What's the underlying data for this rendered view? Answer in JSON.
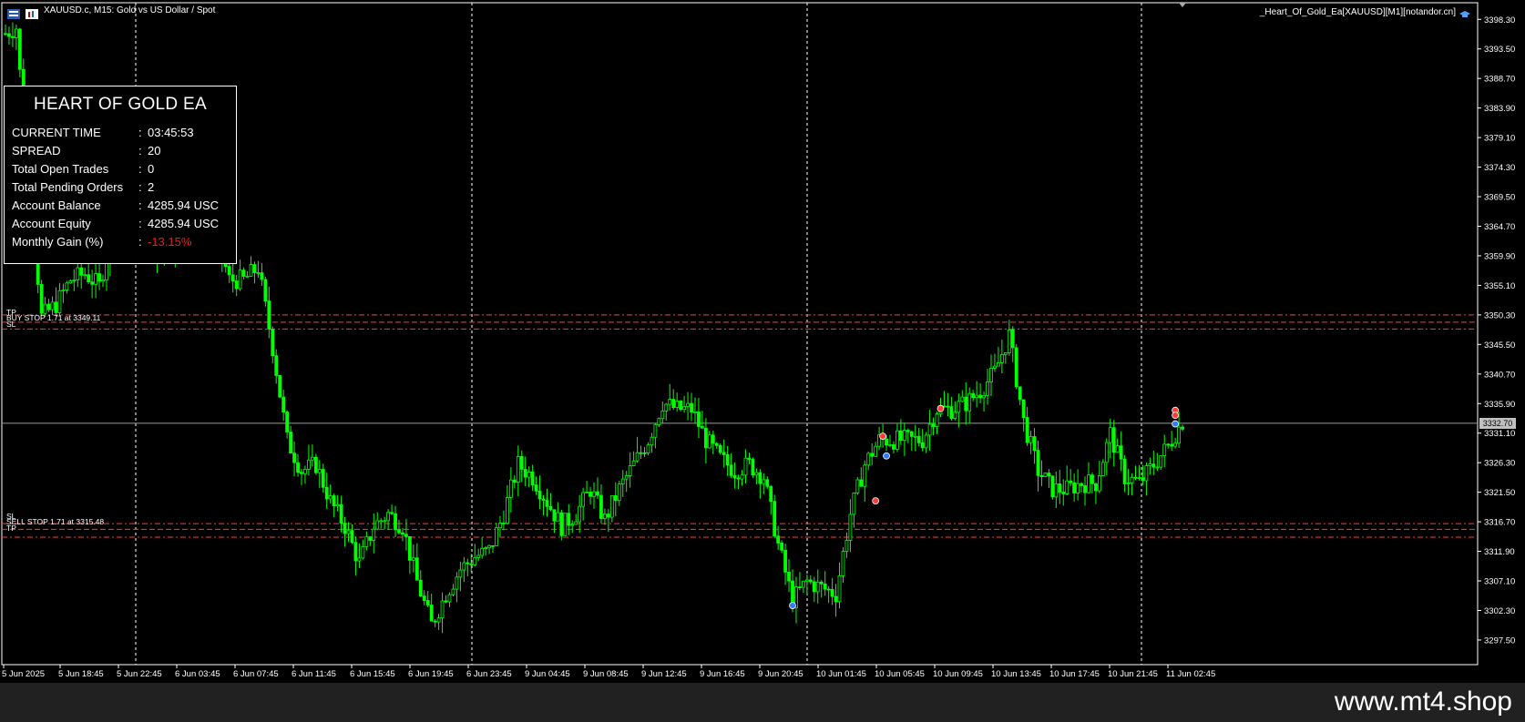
{
  "header": {
    "symbol_title": "XAUUSD.c, M15:  Gold vs US Dollar / Spot",
    "ea_label": "_Heart_Of_Gold_Ea[XAUUSD][M1][notandor.cn]"
  },
  "panel": {
    "title": "HEART OF GOLD EA",
    "rows": [
      {
        "label": "CURRENT TIME",
        "value": "03:45:53"
      },
      {
        "label": "SPREAD",
        "value": "20"
      },
      {
        "label": "Total Open Trades",
        "value": "0"
      },
      {
        "label": "Total Pending Orders",
        "value": "2"
      },
      {
        "label": "Account Balance",
        "value": "4285.94 USC"
      },
      {
        "label": "Account Equity",
        "value": "4285.94 USC"
      },
      {
        "label": "Monthly Gain (%)",
        "value": "-13.15%"
      }
    ],
    "separator": ":",
    "negative_color": "#e0211b"
  },
  "orders": {
    "buy_tp_label": "TP",
    "buy_stop_label": "BUY STOP 1.71 at 3349.11",
    "buy_sl_label": "SL",
    "sell_sl_label": "SL",
    "sell_stop_label": "SELL STOP 1.71 at 3315.48",
    "sell_tp_label": "TP"
  },
  "current_price": "3332.70",
  "footer": {
    "watermark": "www.mt4.shop"
  },
  "colors": {
    "candle": "#00ff00",
    "order_line": "#ff3b3b",
    "grid": "#ffffff",
    "background": "#000000"
  },
  "chart_data": {
    "type": "candlestick",
    "ylim": [
      3293.5,
      3401.0
    ],
    "y_ticks": [
      3398.3,
      3393.5,
      3388.7,
      3383.9,
      3379.1,
      3374.3,
      3369.5,
      3364.7,
      3359.9,
      3355.1,
      3350.3,
      3345.5,
      3340.7,
      3335.9,
      3331.1,
      3326.3,
      3321.5,
      3316.7,
      3311.9,
      3307.1,
      3302.3,
      3297.5
    ],
    "x_ticks": [
      "5 Jun 2025",
      "5 Jun 18:45",
      "5 Jun 22:45",
      "6 Jun 03:45",
      "6 Jun 07:45",
      "6 Jun 11:45",
      "6 Jun 15:45",
      "6 Jun 19:45",
      "6 Jun 23:45",
      "9 Jun 04:45",
      "9 Jun 08:45",
      "9 Jun 12:45",
      "9 Jun 16:45",
      "9 Jun 20:45",
      "10 Jun 01:45",
      "10 Jun 05:45",
      "10 Jun 09:45",
      "10 Jun 13:45",
      "10 Jun 17:45",
      "10 Jun 21:45",
      "11 Jun 02:45"
    ],
    "approx_close_path": [
      [
        0,
        3396
      ],
      [
        3,
        3397
      ],
      [
        6,
        3375
      ],
      [
        10,
        3350
      ],
      [
        14,
        3352
      ],
      [
        18,
        3356
      ],
      [
        22,
        3357
      ],
      [
        26,
        3355
      ],
      [
        30,
        3365
      ],
      [
        34,
        3372
      ],
      [
        38,
        3366
      ],
      [
        42,
        3360
      ],
      [
        46,
        3362
      ],
      [
        50,
        3366
      ],
      [
        54,
        3362
      ],
      [
        58,
        3364
      ],
      [
        62,
        3356
      ],
      [
        66,
        3356
      ],
      [
        70,
        3358
      ],
      [
        74,
        3345
      ],
      [
        78,
        3330
      ],
      [
        82,
        3325
      ],
      [
        86,
        3326
      ],
      [
        90,
        3320
      ],
      [
        94,
        3316
      ],
      [
        98,
        3310
      ],
      [
        102,
        3316
      ],
      [
        106,
        3318
      ],
      [
        110,
        3316
      ],
      [
        114,
        3307
      ],
      [
        118,
        3300
      ],
      [
        122,
        3305
      ],
      [
        126,
        3309
      ],
      [
        130,
        3311
      ],
      [
        134,
        3312
      ],
      [
        138,
        3318
      ],
      [
        142,
        3326
      ],
      [
        146,
        3324
      ],
      [
        150,
        3320
      ],
      [
        154,
        3316
      ],
      [
        158,
        3318
      ],
      [
        162,
        3322
      ],
      [
        166,
        3317
      ],
      [
        170,
        3322
      ],
      [
        174,
        3326
      ],
      [
        178,
        3330
      ],
      [
        182,
        3336
      ],
      [
        186,
        3335
      ],
      [
        190,
        3335
      ],
      [
        194,
        3330
      ],
      [
        198,
        3327
      ],
      [
        202,
        3325
      ],
      [
        206,
        3326
      ],
      [
        210,
        3324
      ],
      [
        214,
        3313
      ],
      [
        218,
        3304
      ],
      [
        222,
        3307
      ],
      [
        226,
        3306
      ],
      [
        230,
        3305
      ],
      [
        234,
        3318
      ],
      [
        238,
        3326
      ],
      [
        242,
        3330
      ],
      [
        246,
        3330
      ],
      [
        250,
        3330
      ],
      [
        254,
        3330
      ],
      [
        258,
        3335
      ],
      [
        262,
        3335
      ],
      [
        266,
        3336
      ],
      [
        270,
        3338
      ],
      [
        274,
        3341
      ],
      [
        278,
        3347
      ],
      [
        282,
        3333
      ],
      [
        286,
        3325
      ],
      [
        290,
        3322
      ],
      [
        294,
        3322
      ],
      [
        298,
        3323
      ],
      [
        302,
        3323
      ],
      [
        306,
        3331
      ],
      [
        310,
        3324
      ],
      [
        314,
        3323
      ],
      [
        318,
        3326
      ],
      [
        322,
        3329
      ],
      [
        326,
        3333
      ]
    ],
    "markers": [
      {
        "type": "buy",
        "x_index": 218,
        "price": 3303.1
      },
      {
        "type": "buy",
        "x_index": 244,
        "price": 3327.4
      },
      {
        "type": "sell",
        "x_index": 243,
        "price": 3330.6
      },
      {
        "type": "sell",
        "x_index": 241,
        "price": 3320.1
      },
      {
        "type": "sell",
        "x_index": 259,
        "price": 3335.1
      },
      {
        "type": "sell",
        "x_index": 324,
        "price": 3334.8
      },
      {
        "type": "sell",
        "x_index": 324,
        "price": 3334.0
      },
      {
        "type": "buy",
        "x_index": 324,
        "price": 3332.6
      }
    ],
    "order_levels": {
      "buy_tp": 3350.3,
      "buy_stop": 3349.11,
      "buy_sl": 3348.0,
      "sell_sl": 3316.4,
      "sell_stop": 3315.48,
      "sell_tp": 3314.2
    }
  }
}
